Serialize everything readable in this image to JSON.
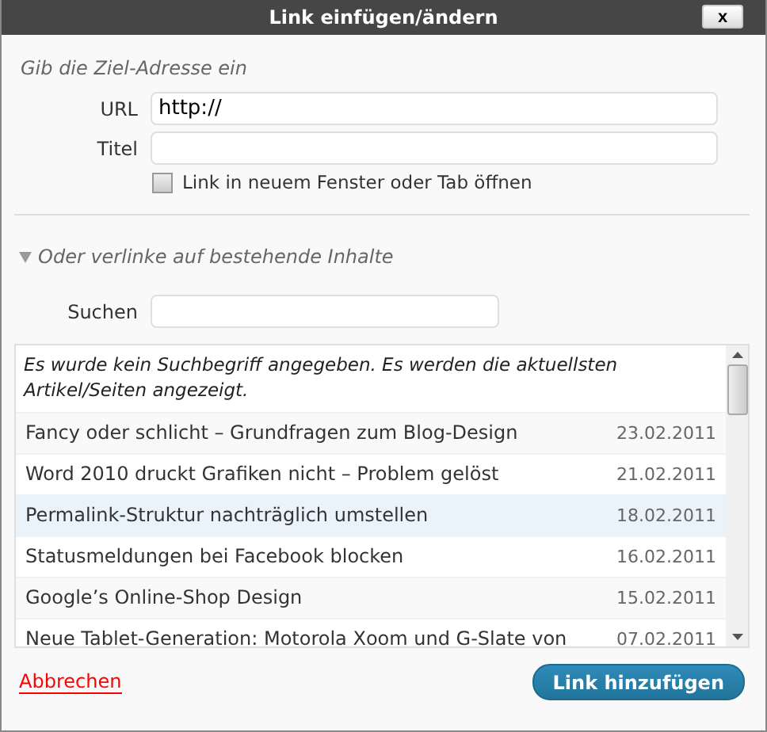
{
  "window": {
    "title": "Link einfügen/ändern",
    "close": "x"
  },
  "target": {
    "heading": "Gib die Ziel-Adresse ein",
    "url_label": "URL",
    "url_value": "http://",
    "title_label": "Titel",
    "new_window": {
      "label": "Link in neuem Fenster oder Tab öffnen",
      "checked": false
    }
  },
  "existing": {
    "heading": "Oder verlinke auf bestehende Inhalte",
    "expanded": true,
    "search_label": "Suchen",
    "notice": "Es wurde kein Suchbegriff angegeben. Es werden die aktuellsten Artikel/Seiten angezeigt.",
    "results": [
      {
        "title": "Fancy oder schlicht – Grundfragen zum Blog-Design",
        "date": "23.02.2011",
        "selected": false
      },
      {
        "title": "Word 2010 druckt Grafiken nicht – Problem gelöst",
        "date": "21.02.2011",
        "selected": false
      },
      {
        "title": "Permalink-Struktur nachträglich umstellen",
        "date": "18.02.2011",
        "selected": true
      },
      {
        "title": "Statusmeldungen bei Facebook blocken",
        "date": "16.02.2011",
        "selected": false
      },
      {
        "title": "Google’s Online-Shop Design",
        "date": "15.02.2011",
        "selected": false
      },
      {
        "title": "Neue Tablet-Generation: Motorola Xoom und G-Slate von",
        "date": "07.02.2011",
        "selected": false
      }
    ]
  },
  "footer": {
    "cancel": "Abbrechen",
    "submit": "Link hinzufügen"
  }
}
